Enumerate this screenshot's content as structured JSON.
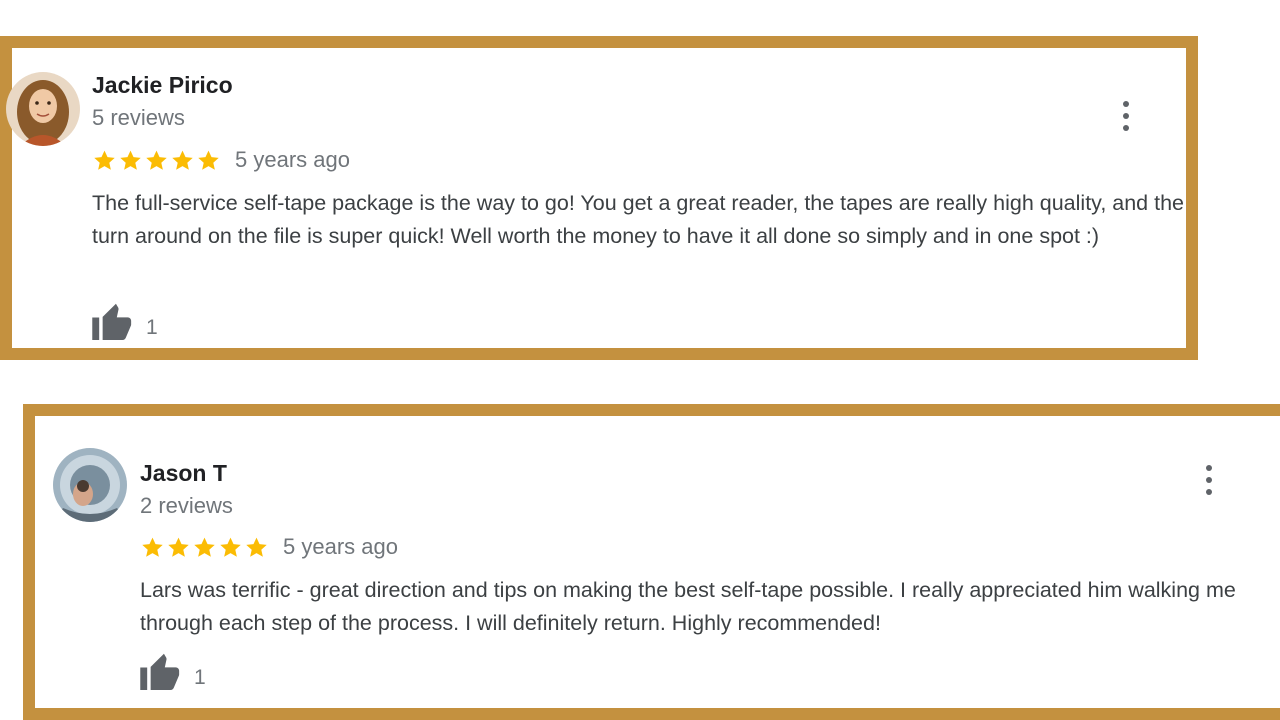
{
  "theme": {
    "frame_color": "#c4913f",
    "star_color": "#fbbc04",
    "icon_color": "#5f6368"
  },
  "reviews": [
    {
      "author": "Jackie Pirico",
      "review_count": "5 reviews",
      "rating": 5,
      "time_ago": "5 years ago",
      "text": "The full-service self-tape package is the way to go! You get a great reader, the tapes are really high quality, and the turn around on the file is super quick! Well worth the money to have it all done so simply and in one spot :)",
      "likes": "1",
      "avatar_icon": "person-photo-icon",
      "like_icon": "thumbs-up-icon",
      "menu_icon": "more-vertical-icon"
    },
    {
      "author": "Jason T",
      "review_count": "2 reviews",
      "rating": 5,
      "time_ago": "5 years ago",
      "text": "Lars was terrific - great direction and tips on making the best self-tape possible.  I really appreciated him walking me through each step of the process.  I will definitely return.  Highly recommended!",
      "likes": "1",
      "avatar_icon": "person-photo-icon",
      "like_icon": "thumbs-up-icon",
      "menu_icon": "more-vertical-icon"
    }
  ]
}
